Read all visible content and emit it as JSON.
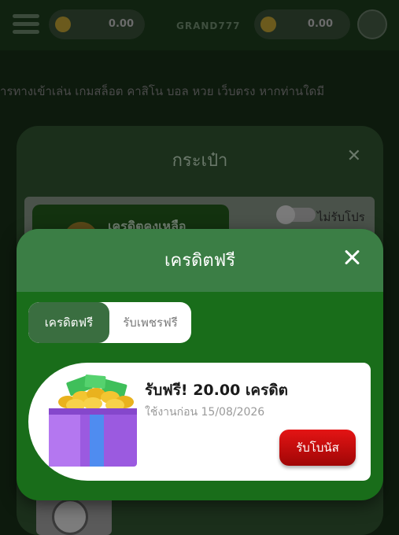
{
  "topbar": {
    "balance_left": "0.00",
    "balance_right": "0.00",
    "logo_text": "GRAND777"
  },
  "marquee": {
    "text": "ารทางเข้าเล่น เกมสล็อต คาสิโน บอล หวย เว็บตรง หากท่านใดมี"
  },
  "wallet": {
    "title": "กระเป๋า",
    "credit_label": "เครดิตคงเหลือ",
    "promo_toggle_label": "ไม่รับโปร"
  },
  "modal": {
    "title": "เครดิตฟรี",
    "tabs": [
      {
        "label": "เครดิตฟรี",
        "active": true
      },
      {
        "label": "รับเพชรฟรี",
        "active": false
      }
    ],
    "offer": {
      "title": "รับฟรี! 20.00 เครดิต",
      "expiry": "ใช้งานก่อน 15/08/2026",
      "button_label": "รับโบนัส"
    }
  },
  "colors": {
    "modal_green": "#196d1a",
    "header_green": "#3b7e45",
    "button_red": "#d40f0f"
  }
}
